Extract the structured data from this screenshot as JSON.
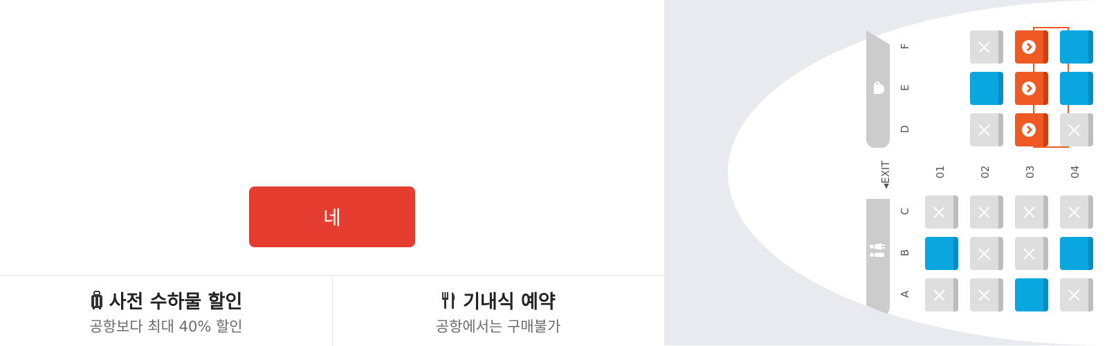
{
  "dialog": {
    "confirm_label": "네"
  },
  "promos": [
    {
      "icon": "luggage-icon",
      "title": "사전 수하물 할인",
      "subtitle": "공항보다 최대 40% 할인"
    },
    {
      "icon": "fork-knife-icon",
      "title": "기내식 예약",
      "subtitle": "공항에서는 구매불가"
    }
  ],
  "seatmap": {
    "exit_label": "◂EXIT",
    "upper_rows": [
      "F",
      "E",
      "D"
    ],
    "lower_rows": [
      "C",
      "B",
      "A"
    ],
    "columns": [
      "01",
      "02",
      "03",
      "04"
    ],
    "panel_icons": {
      "top": "coffee-icon",
      "bottom": "restroom-icon"
    },
    "seats": {
      "F": [
        "none",
        "blocked",
        "selected",
        "open"
      ],
      "E": [
        "none",
        "open",
        "selected",
        "open"
      ],
      "D": [
        "none",
        "blocked",
        "selected",
        "blocked"
      ],
      "C": [
        "blocked",
        "blocked",
        "blocked",
        "blocked"
      ],
      "B": [
        "open",
        "blocked",
        "blocked",
        "open"
      ],
      "A": [
        "blocked",
        "blocked",
        "open",
        "blocked"
      ]
    },
    "colors": {
      "open": "#0aa6e0",
      "selected": "#ef5a24",
      "blocked": "#dedede",
      "confirm": "#e53d30"
    }
  }
}
